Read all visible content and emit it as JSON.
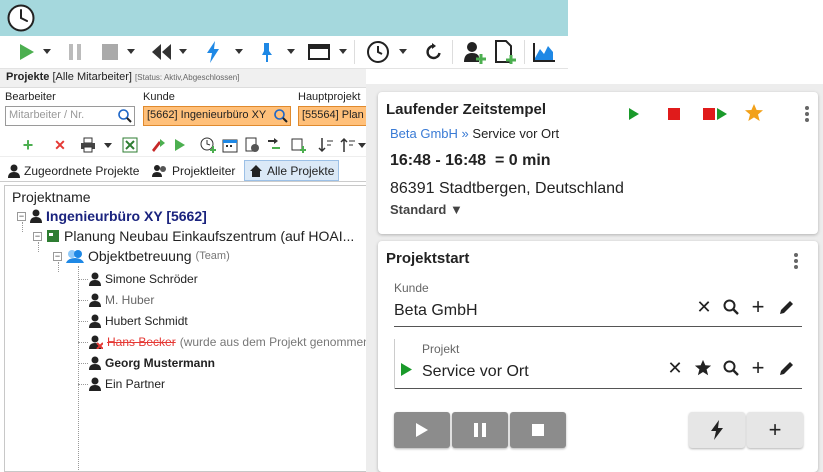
{
  "app": {
    "titlebar_color": "#a5d8dd"
  },
  "toolbar": {
    "icons": [
      "play-icon",
      "pause-icon",
      "stop-icon",
      "rewind-icon",
      "lightning-icon",
      "pin-icon",
      "window-icon",
      "clock-icon",
      "refresh-icon",
      "user-add-icon",
      "document-add-icon",
      "chart-icon"
    ]
  },
  "projects": {
    "header_title": "Projekte",
    "header_filter": "[Alle Mitarbeiter]",
    "header_status": "[Status: Aktiv,Abgeschlossen]",
    "bearbeiter_label": "Bearbeiter",
    "bearbeiter_placeholder": "Mitarbeiter / Nr.",
    "kunde_label": "Kunde",
    "kunde_value": "[5662] Ingenieurbüro XY",
    "hauptprojekt_label": "Hauptprojekt",
    "hauptprojekt_value": "[55564] Plan",
    "tabs": [
      "Zugeordnete Projekte",
      "Projektleiter",
      "Alle Projekte"
    ],
    "tree_header": "Projektname",
    "tree": {
      "root": "Ingenieurbüro XY [5662]",
      "project": "Planung Neubau Einkaufszentrum (auf HOAI...",
      "team": "Objektbetreuung",
      "team_tag": "(Team)",
      "members": [
        {
          "name": "Simone Schröder",
          "style": "normal"
        },
        {
          "name": "M. Huber",
          "style": "gray"
        },
        {
          "name": "Hubert Schmidt",
          "style": "normal"
        },
        {
          "name": "Hans Becker",
          "style": "removed",
          "note": "(wurde aus dem Projekt genommen"
        },
        {
          "name": "Georg Mustermann",
          "style": "bold"
        },
        {
          "name": "Ein Partner",
          "style": "normal"
        }
      ]
    }
  },
  "running": {
    "title": "Laufender Zeitstempel",
    "customer": "Beta GmbH",
    "separator": "»",
    "project": "Service vor Ort",
    "time": "16:48 - 16:48  = 0 min",
    "location": "86391 Stadtbergen, Deutschland",
    "type": "Standard ▼",
    "colors": {
      "play": "#1a9a2a",
      "stop": "#e01b1b",
      "star": "#f2a11a",
      "link": "#3a7bd5"
    }
  },
  "projektstart": {
    "title": "Projektstart",
    "kunde_label": "Kunde",
    "kunde_value": "Beta GmbH",
    "projekt_label": "Projekt",
    "projekt_value": "Service vor Ort"
  }
}
